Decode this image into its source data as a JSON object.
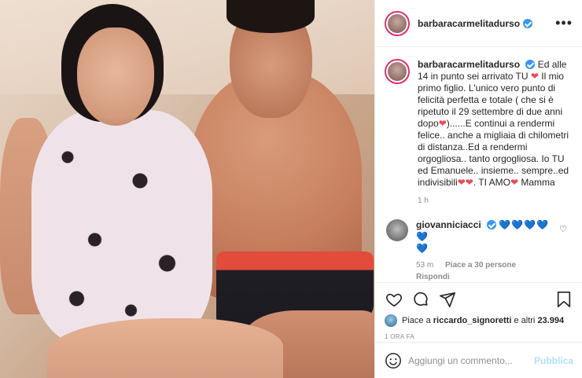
{
  "post": {
    "username": "barbaracarmelitadurso",
    "more_label": "•••",
    "caption_text": "Ed alle 14 in punto sei arrivato TU",
    "caption_text_2": "Il mio primo figlio. L'unico vero punto di felicità perfetta e totale ( che si è ripetuto il 29 settembre di due anni dopo",
    "caption_text_3": ")......E continui a rendermi felice.. anche a migliaia di chilometri di distanza..Ed a rendermi orgogliosa.. tanto orgogliosa. Io TU ed Emanuele.. insieme.. sempre..ed indivisibili",
    "caption_text_4": ". TI AMO",
    "caption_text_5": "Mamma",
    "heart_glyph": "❤",
    "caption_time": "1 h"
  },
  "comment": {
    "username": "giovanniciacci",
    "hearts": "💙💙💙💙💙",
    "heart2": "💙",
    "time": "53 m",
    "likes": "Piace a 30 persone",
    "reply_label": "Rispondi",
    "like_icon": "♡"
  },
  "actions": {
    "liked_by_prefix": "Piace a",
    "liked_by_user": "riccardo_signoretti",
    "liked_by_suffix": "e altri",
    "likes_count": "23.994",
    "post_time": "1 ORA FA"
  },
  "add_comment": {
    "placeholder": "Aggiungi un commento...",
    "publish_label": "Pubblica"
  },
  "colors": {
    "brand_blue": "#3897f0",
    "heart_red": "#ed4956",
    "muted_text": "#8e8e8e"
  },
  "icons": [
    "heart-icon",
    "comment-icon",
    "share-icon",
    "bookmark-icon",
    "emoji-icon",
    "more-icon",
    "verified-icon"
  ]
}
